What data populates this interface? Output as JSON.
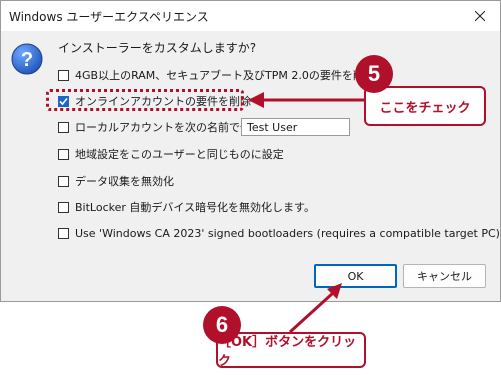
{
  "window": {
    "title": "Windows ユーザーエクスペリエンス"
  },
  "icons": {
    "close": "close-icon",
    "question": "question-icon",
    "check": "check-icon"
  },
  "prompt": {
    "question": "インストーラーをカスタムしますか?"
  },
  "options": [
    {
      "label": "4GB以上のRAM、セキュアブート及びTPM 2.0の要件を削除",
      "checked": false
    },
    {
      "label": "オンラインアカウントの要件を削除",
      "checked": true
    },
    {
      "label": "ローカルアカウントを次の名前で作成:",
      "checked": false
    },
    {
      "label": "地域設定をこのユーザーと同じものに設定",
      "checked": false
    },
    {
      "label": "データ収集を無効化",
      "checked": false
    },
    {
      "label": "BitLocker 自動デバイス暗号化を無効化します。",
      "checked": false
    },
    {
      "label": "Use 'Windows CA 2023' signed bootloaders (requires a compatible target PC)",
      "checked": false
    }
  ],
  "local_account": {
    "value": "Test User"
  },
  "buttons": {
    "ok": "OK",
    "cancel": "キャンセル"
  },
  "annotations": {
    "step5": {
      "number": "5",
      "text": "ここをチェック"
    },
    "step6": {
      "number": "6",
      "text": "［OK］ボタンをクリック"
    }
  },
  "colors": {
    "accent": "#b0102a",
    "focus": "#0067c0",
    "check": "#1a66c9"
  }
}
